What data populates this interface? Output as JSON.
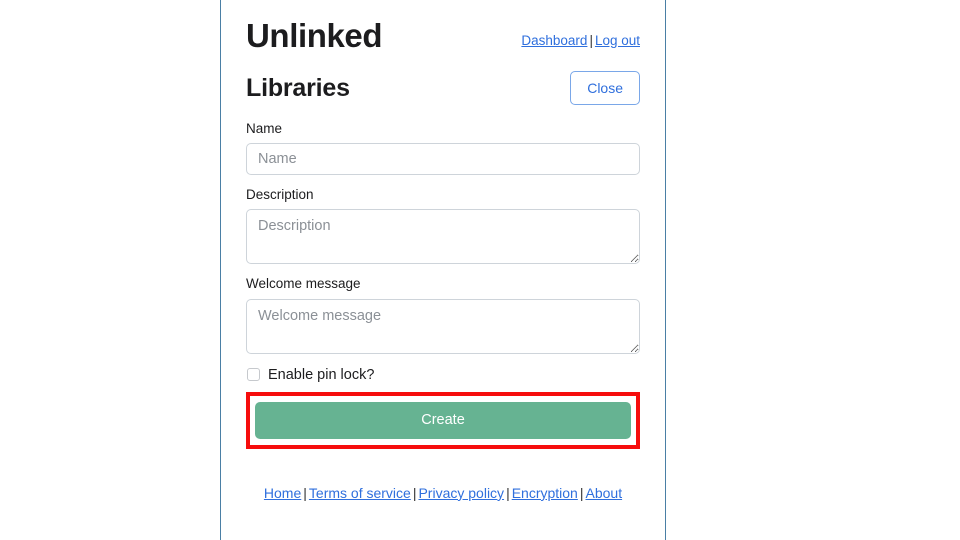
{
  "header": {
    "brand": "Unlinked",
    "links": [
      {
        "label": "Dashboard",
        "name": "dashboard-link"
      },
      {
        "label": "Log out",
        "name": "log-out-link"
      }
    ],
    "separator": "|"
  },
  "page": {
    "title": "Libraries",
    "close_label": "Close"
  },
  "form": {
    "name": {
      "label": "Name",
      "placeholder": "Name",
      "value": ""
    },
    "description": {
      "label": "Description",
      "placeholder": "Description",
      "value": ""
    },
    "welcome_message": {
      "label": "Welcome message",
      "placeholder": "Welcome message",
      "value": ""
    },
    "pin_lock": {
      "label": "Enable pin lock?",
      "checked": false
    },
    "submit_label": "Create"
  },
  "footer": {
    "separator": "|",
    "links": [
      {
        "label": "Home",
        "name": "home-link"
      },
      {
        "label": "Terms of service",
        "name": "terms-of-service-link"
      },
      {
        "label": "Privacy policy",
        "name": "privacy-policy-link"
      },
      {
        "label": "Encryption",
        "name": "encryption-link"
      },
      {
        "label": "About",
        "name": "about-link"
      }
    ]
  },
  "annotation": {
    "highlight_color": "#f60d0d",
    "target": "Create"
  },
  "colors": {
    "accent_link": "#2f6fdd",
    "submit_green": "#66b392",
    "container_rule": "#4a7fa5",
    "input_border": "#ced4da",
    "placeholder": "#8b9096"
  }
}
